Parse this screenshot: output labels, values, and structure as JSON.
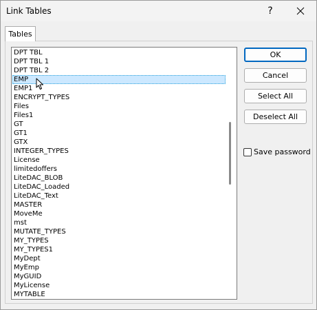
{
  "window": {
    "title": "Link Tables",
    "help_glyph": "?"
  },
  "tabs": [
    {
      "label": "Tables"
    }
  ],
  "table_list": {
    "items": [
      "DPT TBL",
      "DPT TBL 1",
      "DPT TBL 2",
      "EMP",
      "EMP1",
      "ENCRYPT_TYPES",
      "Files",
      "Files1",
      "GT",
      "GT1",
      "GTX",
      "INTEGER_TYPES",
      "License",
      "limitedoffers",
      "LiteDAC_BLOB",
      "LiteDAC_Loaded",
      "LiteDAC_Text",
      "MASTER",
      "MoveMe",
      "mst",
      "MUTATE_TYPES",
      "MY_TYPES",
      "MY_TYPES1",
      "MyDept",
      "MyEmp",
      "MyGUID",
      "MyLicense",
      "MYTABLE"
    ],
    "selected": "EMP"
  },
  "buttons": {
    "ok": "OK",
    "cancel": "Cancel",
    "select_all": "Select All",
    "deselect_all": "Deselect All"
  },
  "save_password": {
    "label": "Save password",
    "checked": false
  },
  "colors": {
    "selection": "#cce8ff",
    "default_button_border": "#0067c0"
  },
  "icons": {
    "close": "close-icon",
    "help": "help-icon",
    "cursor": "mouse-pointer-icon"
  }
}
